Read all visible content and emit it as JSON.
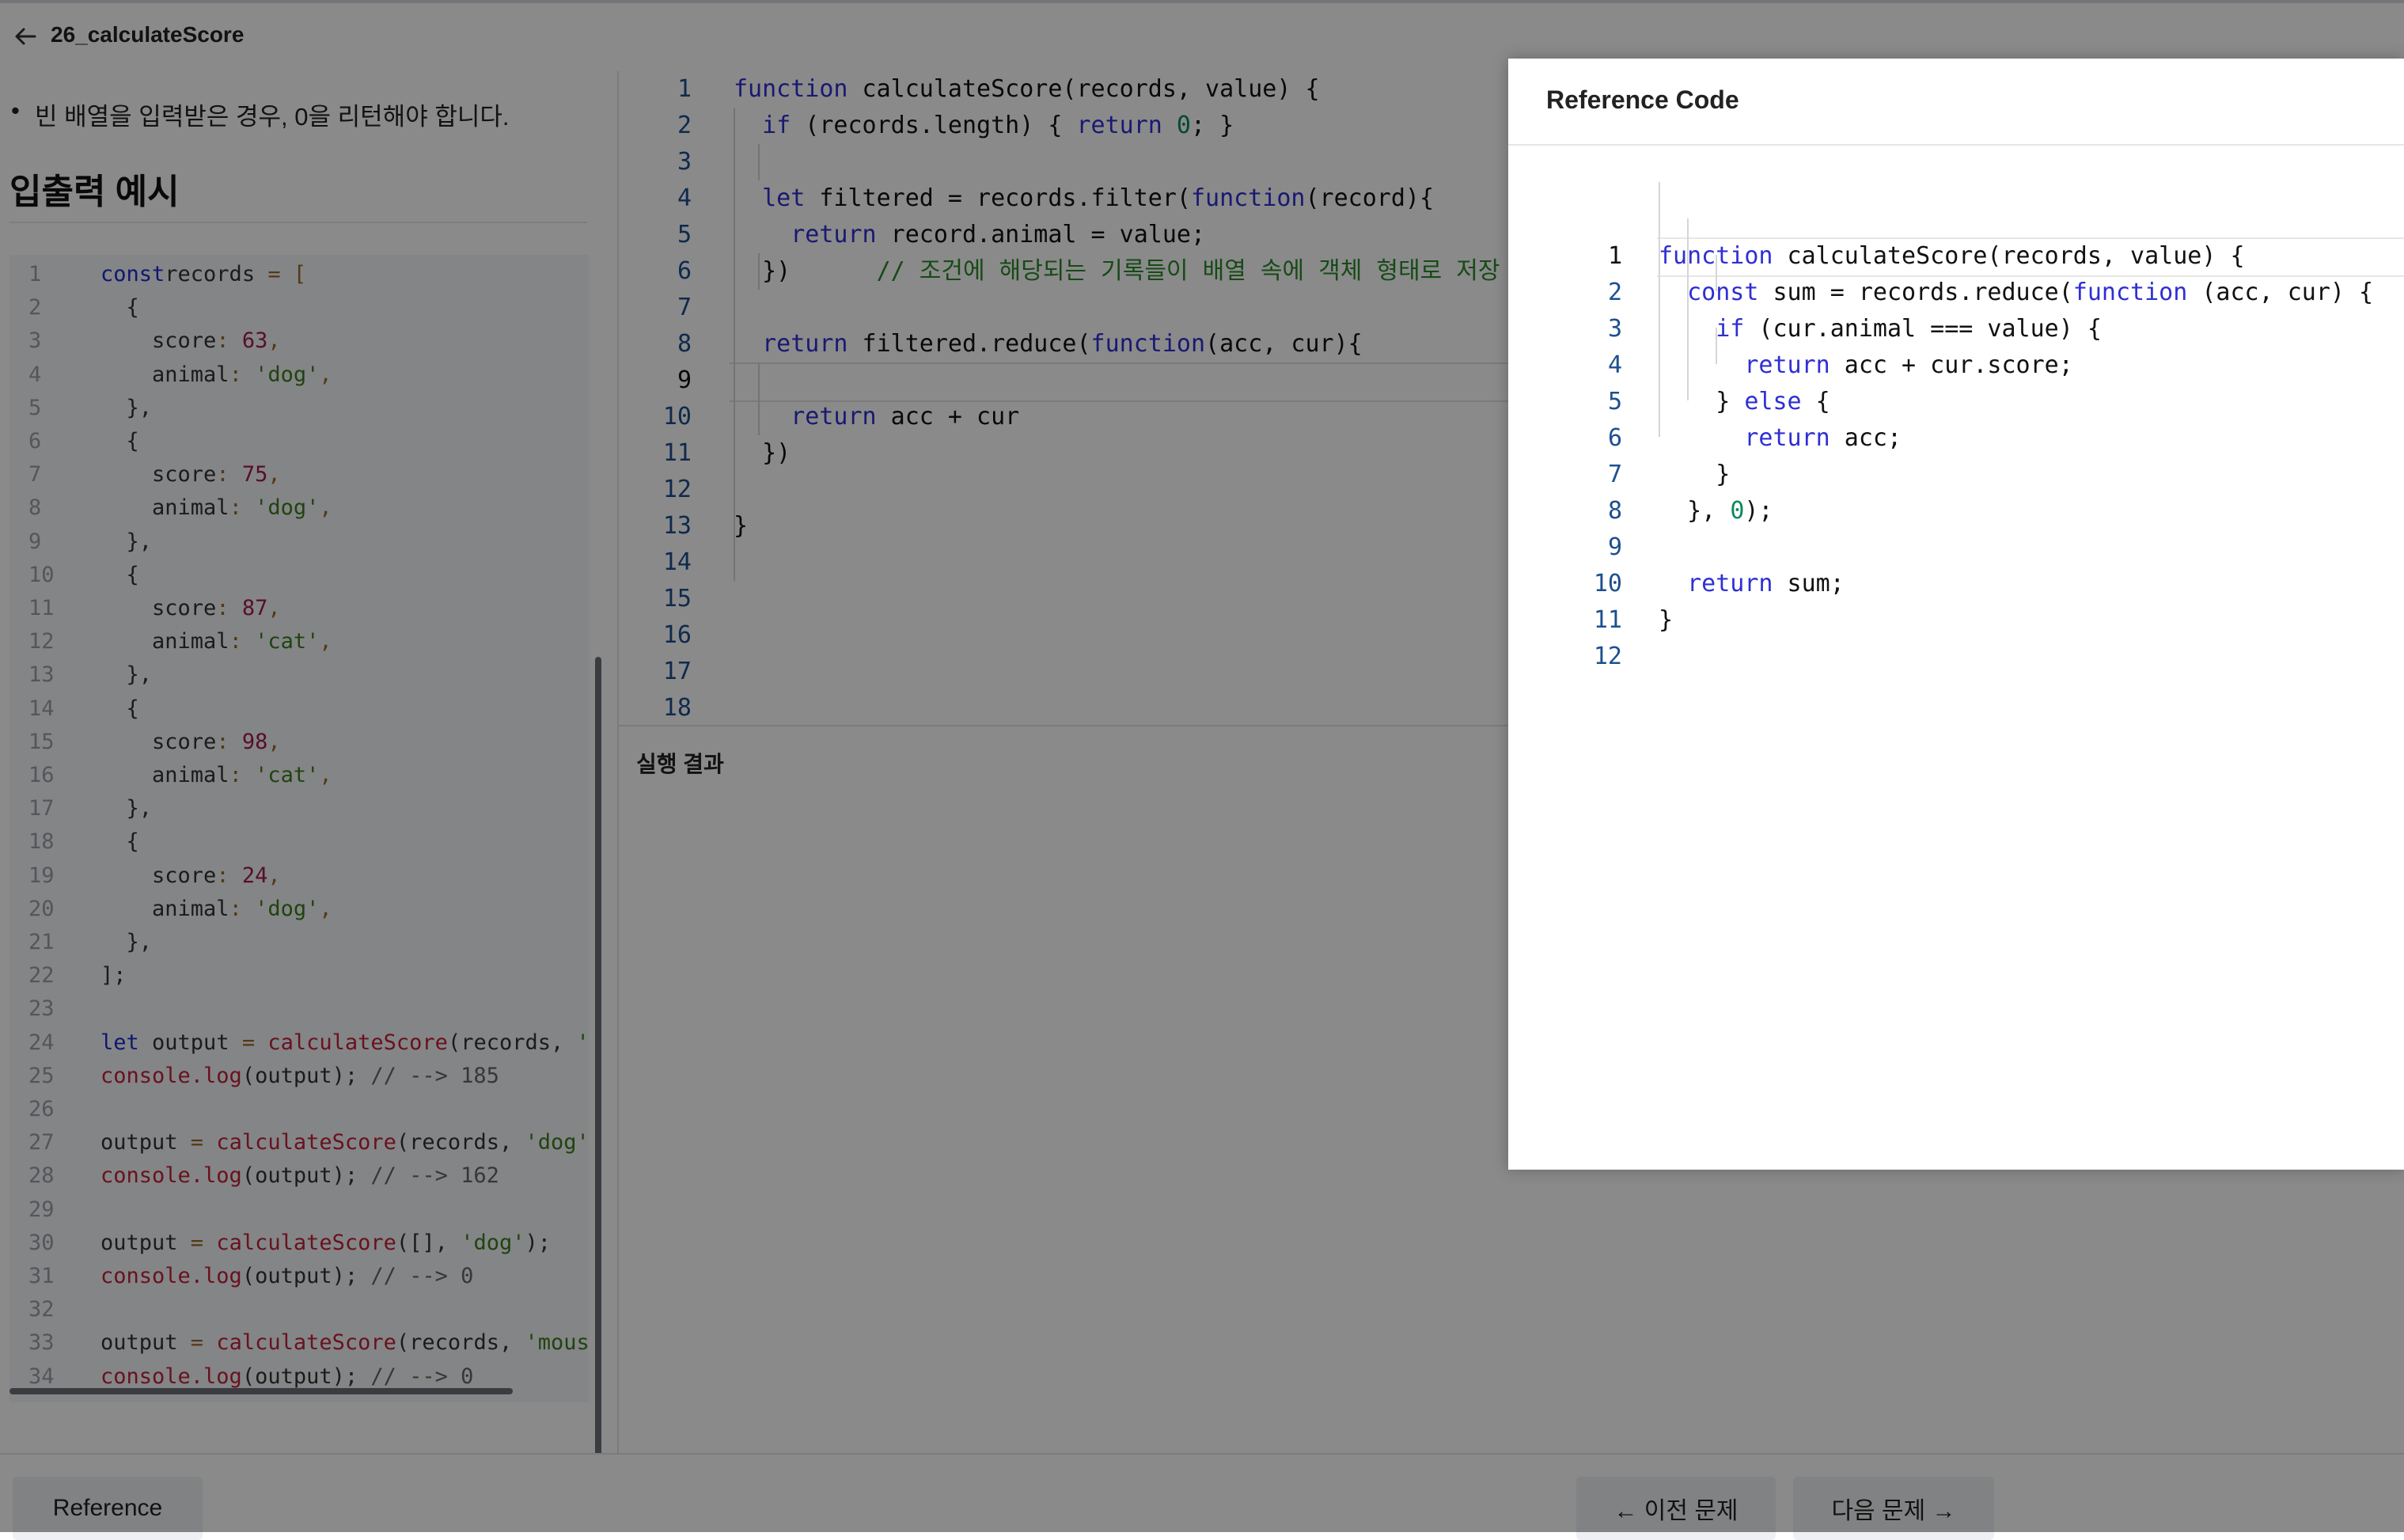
{
  "header": {
    "title": "26_calculateScore"
  },
  "problem": {
    "bullet": "빈 배열을 입력받은 경우, 0을 리턴해야 합니다.",
    "io_heading": "입출력 예시"
  },
  "example": {
    "lines": [
      {
        "n": "1",
        "segs": [
          [
            "kw",
            "const"
          ],
          [
            "",
            "records "
          ],
          [
            "op",
            "="
          ],
          [
            "",
            " "
          ],
          [
            "op",
            "["
          ]
        ]
      },
      {
        "n": "2",
        "segs": [
          [
            "",
            "  {"
          ]
        ]
      },
      {
        "n": "3",
        "segs": [
          [
            "",
            "    score"
          ],
          [
            "op",
            ":"
          ],
          [
            "",
            " "
          ],
          [
            "num",
            "63"
          ],
          [
            "op",
            ","
          ]
        ]
      },
      {
        "n": "4",
        "segs": [
          [
            "",
            "    animal"
          ],
          [
            "op",
            ":"
          ],
          [
            "",
            " "
          ],
          [
            "str",
            "'dog'"
          ],
          [
            "op",
            ","
          ]
        ]
      },
      {
        "n": "5",
        "segs": [
          [
            "",
            "  },"
          ]
        ]
      },
      {
        "n": "6",
        "segs": [
          [
            "",
            "  {"
          ]
        ]
      },
      {
        "n": "7",
        "segs": [
          [
            "",
            "    score"
          ],
          [
            "op",
            ":"
          ],
          [
            "",
            " "
          ],
          [
            "num",
            "75"
          ],
          [
            "op",
            ","
          ]
        ]
      },
      {
        "n": "8",
        "segs": [
          [
            "",
            "    animal"
          ],
          [
            "op",
            ":"
          ],
          [
            "",
            " "
          ],
          [
            "str",
            "'dog'"
          ],
          [
            "op",
            ","
          ]
        ]
      },
      {
        "n": "9",
        "segs": [
          [
            "",
            "  },"
          ]
        ]
      },
      {
        "n": "10",
        "segs": [
          [
            "",
            "  {"
          ]
        ]
      },
      {
        "n": "11",
        "segs": [
          [
            "",
            "    score"
          ],
          [
            "op",
            ":"
          ],
          [
            "",
            " "
          ],
          [
            "num",
            "87"
          ],
          [
            "op",
            ","
          ]
        ]
      },
      {
        "n": "12",
        "segs": [
          [
            "",
            "    animal"
          ],
          [
            "op",
            ":"
          ],
          [
            "",
            " "
          ],
          [
            "str",
            "'cat'"
          ],
          [
            "op",
            ","
          ]
        ]
      },
      {
        "n": "13",
        "segs": [
          [
            "",
            "  },"
          ]
        ]
      },
      {
        "n": "14",
        "segs": [
          [
            "",
            "  {"
          ]
        ]
      },
      {
        "n": "15",
        "segs": [
          [
            "",
            "    score"
          ],
          [
            "op",
            ":"
          ],
          [
            "",
            " "
          ],
          [
            "num",
            "98"
          ],
          [
            "op",
            ","
          ]
        ]
      },
      {
        "n": "16",
        "segs": [
          [
            "",
            "    animal"
          ],
          [
            "op",
            ":"
          ],
          [
            "",
            " "
          ],
          [
            "str",
            "'cat'"
          ],
          [
            "op",
            ","
          ]
        ]
      },
      {
        "n": "17",
        "segs": [
          [
            "",
            "  },"
          ]
        ]
      },
      {
        "n": "18",
        "segs": [
          [
            "",
            "  {"
          ]
        ]
      },
      {
        "n": "19",
        "segs": [
          [
            "",
            "    score"
          ],
          [
            "op",
            ":"
          ],
          [
            "",
            " "
          ],
          [
            "num",
            "24"
          ],
          [
            "op",
            ","
          ]
        ]
      },
      {
        "n": "20",
        "segs": [
          [
            "",
            "    animal"
          ],
          [
            "op",
            ":"
          ],
          [
            "",
            " "
          ],
          [
            "str",
            "'dog'"
          ],
          [
            "op",
            ","
          ]
        ]
      },
      {
        "n": "21",
        "segs": [
          [
            "",
            "  },"
          ]
        ]
      },
      {
        "n": "22",
        "segs": [
          [
            "",
            "];"
          ]
        ]
      },
      {
        "n": "23",
        "segs": []
      },
      {
        "n": "24",
        "segs": [
          [
            "kw",
            "let"
          ],
          [
            "",
            " output "
          ],
          [
            "op",
            "="
          ],
          [
            "",
            " "
          ],
          [
            "fn",
            "calculateScore"
          ],
          [
            "",
            "(records, "
          ],
          [
            "str",
            "'c"
          ]
        ]
      },
      {
        "n": "25",
        "segs": [
          [
            "fn",
            "console.log"
          ],
          [
            "",
            "(output); "
          ],
          [
            "cm",
            "// --> 185"
          ]
        ]
      },
      {
        "n": "26",
        "segs": []
      },
      {
        "n": "27",
        "segs": [
          [
            "",
            "output "
          ],
          [
            "op",
            "="
          ],
          [
            "",
            " "
          ],
          [
            "fn",
            "calculateScore"
          ],
          [
            "",
            "(records, "
          ],
          [
            "str",
            "'dog'"
          ],
          [
            "",
            ")"
          ]
        ]
      },
      {
        "n": "28",
        "segs": [
          [
            "fn",
            "console.log"
          ],
          [
            "",
            "(output); "
          ],
          [
            "cm",
            "// --> 162"
          ]
        ]
      },
      {
        "n": "29",
        "segs": []
      },
      {
        "n": "30",
        "segs": [
          [
            "",
            "output "
          ],
          [
            "op",
            "="
          ],
          [
            "",
            " "
          ],
          [
            "fn",
            "calculateScore"
          ],
          [
            "",
            "([], "
          ],
          [
            "str",
            "'dog'"
          ],
          [
            "",
            ");"
          ]
        ]
      },
      {
        "n": "31",
        "segs": [
          [
            "fn",
            "console.log"
          ],
          [
            "",
            "(output); "
          ],
          [
            "cm",
            "// --> 0"
          ]
        ]
      },
      {
        "n": "32",
        "segs": []
      },
      {
        "n": "33",
        "segs": [
          [
            "",
            "output "
          ],
          [
            "op",
            "="
          ],
          [
            "",
            " "
          ],
          [
            "fn",
            "calculateScore"
          ],
          [
            "",
            "(records, "
          ],
          [
            "str",
            "'mouse"
          ]
        ]
      },
      {
        "n": "34",
        "segs": [
          [
            "fn",
            "console.log"
          ],
          [
            "",
            "(output); "
          ],
          [
            "cm",
            "// --> 0"
          ]
        ]
      }
    ]
  },
  "editor": {
    "lines": [
      {
        "n": "1",
        "segs": [
          [
            "kw2",
            "function"
          ],
          [
            "",
            " calculateScore(records, value) {"
          ]
        ]
      },
      {
        "n": "2",
        "segs": [
          [
            "",
            "  "
          ],
          [
            "kw2",
            "if"
          ],
          [
            "",
            " (records.length) { "
          ],
          [
            "kw2",
            "return"
          ],
          [
            "",
            " "
          ],
          [
            "numg",
            "0"
          ],
          [
            "",
            "; }"
          ]
        ]
      },
      {
        "n": "3",
        "segs": []
      },
      {
        "n": "4",
        "segs": [
          [
            "",
            "  "
          ],
          [
            "kw2",
            "let"
          ],
          [
            "",
            " filtered = records.filter("
          ],
          [
            "kw2",
            "function"
          ],
          [
            "",
            "(record){"
          ]
        ]
      },
      {
        "n": "5",
        "segs": [
          [
            "",
            "    "
          ],
          [
            "kw2",
            "return"
          ],
          [
            "",
            " record.animal = value;"
          ]
        ]
      },
      {
        "n": "6",
        "segs": [
          [
            "",
            "  })      "
          ],
          [
            "green",
            "// 조건에 해당되는 기록들이 배열 속에 객체 형태로 저장"
          ]
        ]
      },
      {
        "n": "7",
        "segs": []
      },
      {
        "n": "8",
        "segs": [
          [
            "",
            "  "
          ],
          [
            "kw2",
            "return"
          ],
          [
            "",
            " filtered.reduce("
          ],
          [
            "kw2",
            "function"
          ],
          [
            "",
            "(acc, cur){"
          ]
        ]
      },
      {
        "n": "9",
        "segs": []
      },
      {
        "n": "10",
        "segs": [
          [
            "",
            "    "
          ],
          [
            "kw2",
            "return"
          ],
          [
            "",
            " acc + cur"
          ]
        ]
      },
      {
        "n": "11",
        "segs": [
          [
            "",
            "  })"
          ]
        ]
      },
      {
        "n": "12",
        "segs": []
      },
      {
        "n": "13",
        "segs": [
          [
            "",
            "}"
          ]
        ]
      },
      {
        "n": "14",
        "segs": []
      },
      {
        "n": "15",
        "segs": []
      },
      {
        "n": "16",
        "segs": []
      },
      {
        "n": "17",
        "segs": []
      },
      {
        "n": "18",
        "segs": []
      }
    ]
  },
  "results": {
    "label": "실행 결과"
  },
  "footer": {
    "reference_label": "Reference",
    "prev_label": "← 이전 문제",
    "next_label": "다음 문제 →"
  },
  "modal": {
    "title": "Reference Code",
    "lines": [
      {
        "n": "1",
        "segs": [
          [
            "kw2",
            "function"
          ],
          [
            "",
            " calculateScore(records, value) {"
          ]
        ]
      },
      {
        "n": "2",
        "segs": [
          [
            "",
            "  "
          ],
          [
            "kw2",
            "const"
          ],
          [
            "",
            " sum = records.reduce("
          ],
          [
            "kw2",
            "function"
          ],
          [
            "",
            " (acc, cur) {"
          ]
        ]
      },
      {
        "n": "3",
        "segs": [
          [
            "",
            "    "
          ],
          [
            "kw2",
            "if"
          ],
          [
            "",
            " (cur.animal === value) {"
          ]
        ]
      },
      {
        "n": "4",
        "segs": [
          [
            "",
            "      "
          ],
          [
            "kw2",
            "return"
          ],
          [
            "",
            " acc + cur.score;"
          ]
        ]
      },
      {
        "n": "5",
        "segs": [
          [
            "",
            "    } "
          ],
          [
            "kw2",
            "else"
          ],
          [
            "",
            " {"
          ]
        ]
      },
      {
        "n": "6",
        "segs": [
          [
            "",
            "      "
          ],
          [
            "kw2",
            "return"
          ],
          [
            "",
            " acc;"
          ]
        ]
      },
      {
        "n": "7",
        "segs": [
          [
            "",
            "    }"
          ]
        ]
      },
      {
        "n": "8",
        "segs": [
          [
            "",
            "  }, "
          ],
          [
            "numg",
            "0"
          ],
          [
            "",
            ");"
          ]
        ]
      },
      {
        "n": "9",
        "segs": []
      },
      {
        "n": "10",
        "segs": [
          [
            "",
            "  "
          ],
          [
            "kw2",
            "return"
          ],
          [
            "",
            " sum;"
          ]
        ]
      },
      {
        "n": "11",
        "segs": [
          [
            "",
            "}"
          ]
        ]
      },
      {
        "n": "12",
        "segs": []
      }
    ]
  }
}
